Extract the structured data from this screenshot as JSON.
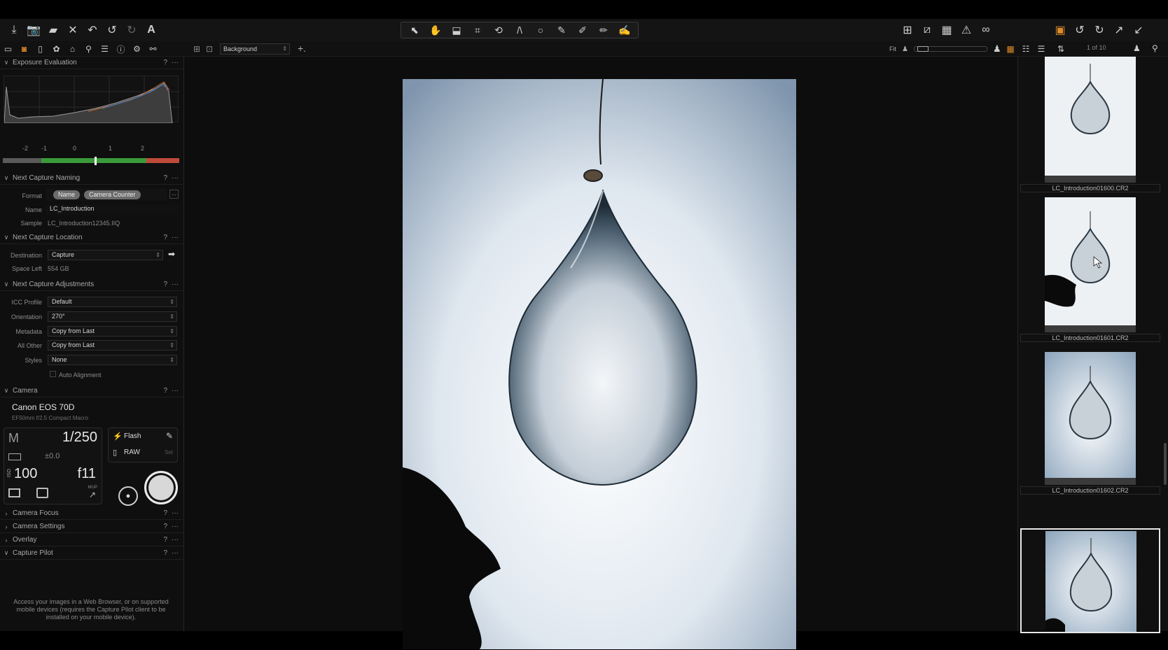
{
  "subbar": {
    "layer": "Background",
    "fit_label": "Fit",
    "page_count": "1 of 10"
  },
  "left": {
    "exposure": {
      "title": "Exposure Evaluation",
      "help": "?",
      "more": "···",
      "scale": [
        "-2",
        "-1",
        "0",
        "1",
        "2"
      ],
      "exposure_level": 0.0
    },
    "naming": {
      "title": "Next Capture Naming",
      "help": "?",
      "more": "···",
      "format_label": "Format",
      "format_tokens": [
        "Name",
        "Camera Counter"
      ],
      "format_more": "...",
      "name_label": "Name",
      "name_value": "LC_Introduction",
      "sample_label": "Sample",
      "sample_value": "LC_Introduction12345.IIQ"
    },
    "location": {
      "title": "Next Capture Location",
      "help": "?",
      "more": "···",
      "destination_label": "Destination",
      "destination_value": "Capture",
      "space_label": "Space Left",
      "space_value": "554 GB"
    },
    "adjustments": {
      "title": "Next Capture Adjustments",
      "help": "?",
      "more": "···",
      "icc_label": "ICC Profile",
      "icc_value": "Default",
      "orientation_label": "Orientation",
      "orientation_value": "270°",
      "metadata_label": "Metadata",
      "metadata_value": "Copy from Last",
      "allother_label": "All Other",
      "allother_value": "Copy from Last",
      "styles_label": "Styles",
      "styles_value": "None",
      "auto_alignment": "Auto Alignment"
    },
    "camera": {
      "title": "Camera",
      "help": "?",
      "more": "···",
      "name": "Canon EOS 70D",
      "lens": "EF50mm f/2.5 Compact Macro",
      "mode": "M",
      "shutter": "1/250",
      "ev": "±0.0",
      "iso_label": "ISO",
      "iso": "100",
      "aperture": "f11",
      "flash": "Flash",
      "format": "RAW",
      "set": "Set",
      "mup": "MUP"
    },
    "collapsed": [
      {
        "title": "Camera Focus"
      },
      {
        "title": "Camera Settings"
      },
      {
        "title": "Overlay"
      }
    ],
    "capture_pilot": {
      "title": "Capture Pilot",
      "text": "Access your images in a Web Browser, or on supported mobile devices (requires the Capture Pilot client to be installed on your mobile device)."
    }
  },
  "browser": {
    "thumbs": [
      {
        "name": "LC_Introduction01600.CR2"
      },
      {
        "name": "LC_Introduction01601.CR2"
      },
      {
        "name": "LC_Introduction01602.CR2"
      },
      {
        "name": ""
      }
    ]
  }
}
